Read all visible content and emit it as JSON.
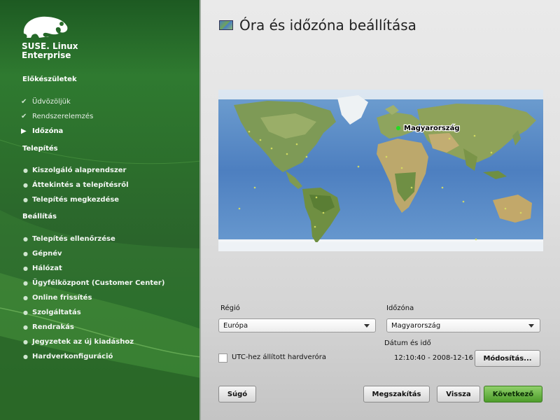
{
  "brand": {
    "line1": "SUSE. Linux",
    "line2": "Enterprise"
  },
  "sidebar": {
    "sections": [
      {
        "label": "Előkészületek"
      },
      {
        "label": "Telepítés"
      },
      {
        "label": "Beállítás"
      }
    ],
    "prep_items": [
      {
        "label": "Üdvözöljük",
        "state": "done"
      },
      {
        "label": "Rendszerelemzés",
        "state": "done"
      },
      {
        "label": "Időzóna",
        "state": "current"
      }
    ],
    "install_items": [
      {
        "label": "Kiszolgáló alaprendszer"
      },
      {
        "label": "Áttekintés a telepítésről"
      },
      {
        "label": "Telepítés megkezdése"
      }
    ],
    "config_items": [
      {
        "label": "Telepítés ellenőrzése"
      },
      {
        "label": "Gépnév"
      },
      {
        "label": "Hálózat"
      },
      {
        "label": "Ügyfélközpont (Customer Center)"
      },
      {
        "label": "Online frissítés"
      },
      {
        "label": "Szolgáltatás"
      },
      {
        "label": "Rendrakás"
      },
      {
        "label": "Jegyzetek az új kiadáshoz"
      },
      {
        "label": "Hardverkonfiguráció"
      }
    ]
  },
  "page": {
    "title": "Óra és időzóna beállítása"
  },
  "map": {
    "selected_label": "Magyarország"
  },
  "region": {
    "label": "Régió",
    "value": "Európa"
  },
  "timezone": {
    "label": "Időzóna",
    "value": "Magyarország"
  },
  "datetime": {
    "label": "Dátum és idő",
    "value": "12:10:40 - 2008-12-16"
  },
  "utc": {
    "label": "UTC-hez állított hardveróra",
    "checked": false
  },
  "buttons": {
    "change": "Módosítás...",
    "help": "Súgó",
    "abort": "Megszakítás",
    "back": "Vissza",
    "next": "Következő"
  },
  "colors": {
    "accent": "#4e9d2b",
    "sidebar": "#2c6e2c"
  }
}
